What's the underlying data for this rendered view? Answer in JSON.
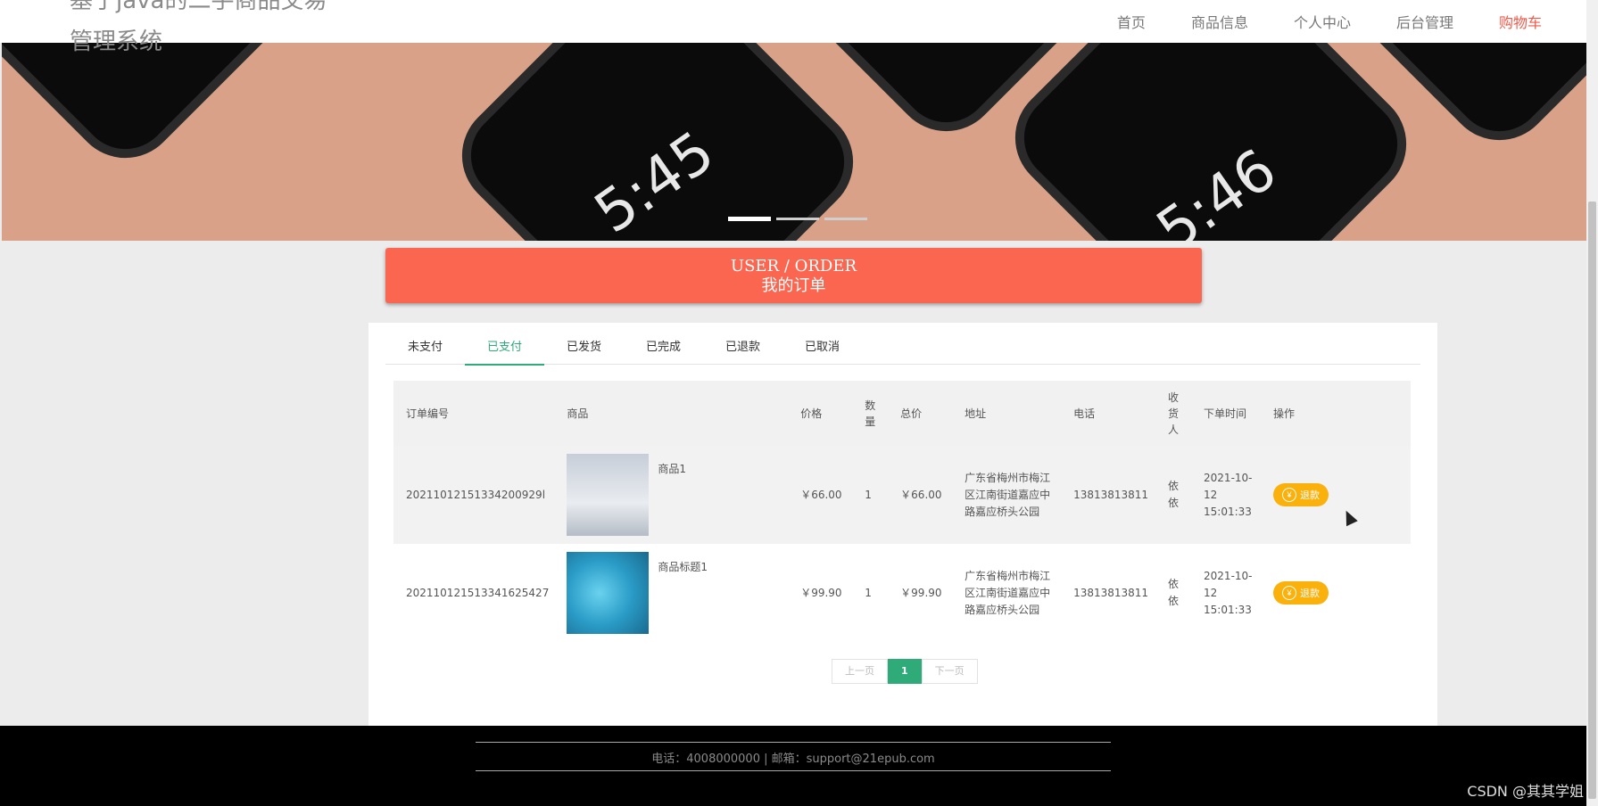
{
  "nav": {
    "site_title": "基于java的二手商品交易管理系统",
    "links": [
      "首页",
      "商品信息",
      "个人中心",
      "后台管理",
      "购物车"
    ]
  },
  "banner": {
    "clock_left": "5:45",
    "clock_right": "5:46",
    "carousel_indicator_count": 3
  },
  "order_header": {
    "title_en": "USER / ORDER",
    "title_cn": "我的订单"
  },
  "tabs": [
    "未支付",
    "已支付",
    "已发货",
    "已完成",
    "已退款",
    "已取消"
  ],
  "active_tab": "已支付",
  "table": {
    "headers": [
      "订单编号",
      "商品",
      "价格",
      "数量",
      "总价",
      "地址",
      "电话",
      "收货人",
      "下单时间",
      "操作"
    ],
    "rows": [
      {
        "order_no": "20211012151334200929l",
        "product_name": "商品1",
        "price": "￥66.00",
        "qty": "1",
        "total": "￥66.00",
        "address": "广东省梅州市梅江区江南街道嘉应中路嘉应桥头公园",
        "phone": "13813813811",
        "receiver": "依依",
        "time": "2021-10-12 15:01:33",
        "action": "退款"
      },
      {
        "order_no": "202110121513341625427",
        "product_name": "商品标题1",
        "price": "￥99.90",
        "qty": "1",
        "total": "￥99.90",
        "address": "广东省梅州市梅江区江南街道嘉应中路嘉应桥头公园",
        "phone": "13813813811",
        "receiver": "依依",
        "time": "2021-10-12 15:01:33",
        "action": "退款"
      }
    ]
  },
  "pager": {
    "prev": "上一页",
    "current": "1",
    "next": "下一页"
  },
  "footer": {
    "contact": "电话：4008000000 | 邮箱：support@21epub.com"
  },
  "watermark": "CSDN @其其学姐",
  "colors": {
    "accent_red": "#fb6651",
    "active_green": "#2eab79",
    "refund_yellow": "#fbb10c",
    "nav_cart": "#f15a4a"
  }
}
